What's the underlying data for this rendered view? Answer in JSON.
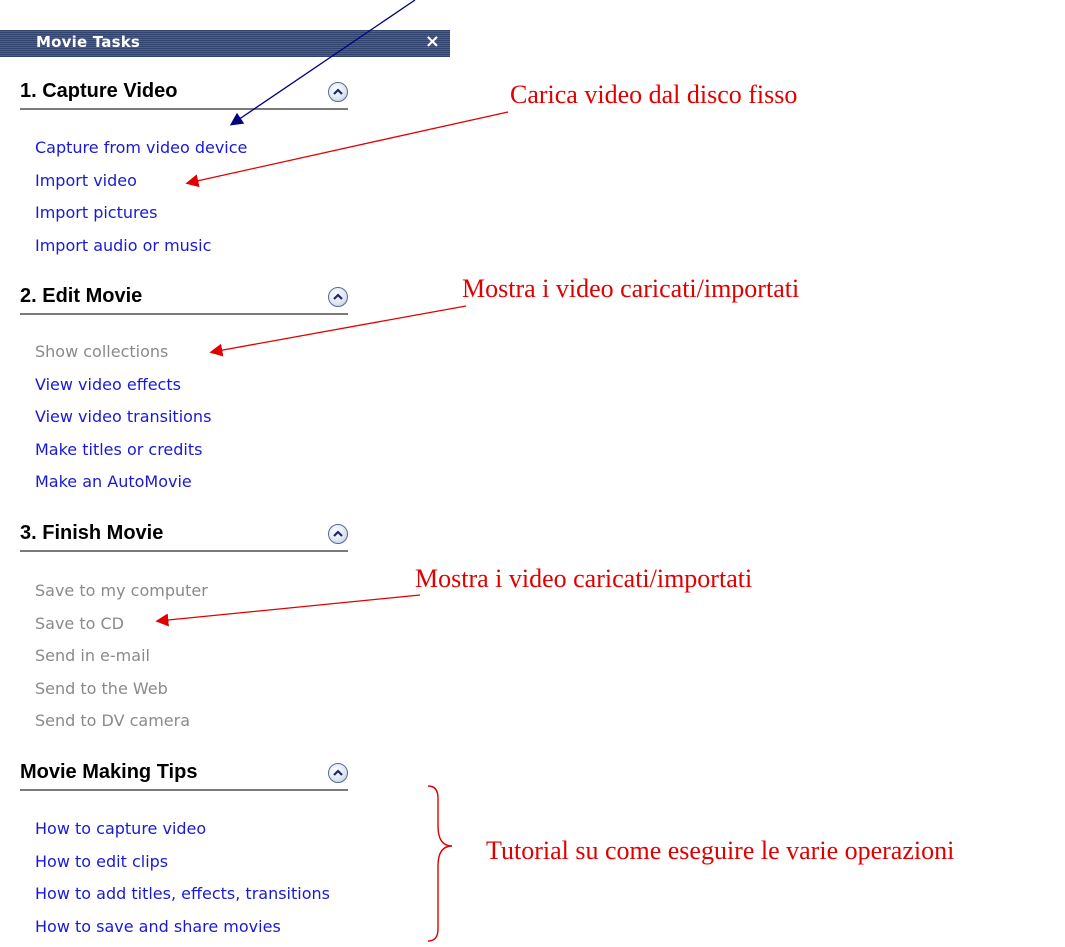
{
  "panel": {
    "title": "Movie Tasks",
    "close_glyph": "×"
  },
  "sections": [
    {
      "heading": "1. Capture Video",
      "links": [
        {
          "label": "Capture from video device",
          "state": "active"
        },
        {
          "label": "Import video",
          "state": "active"
        },
        {
          "label": "Import pictures",
          "state": "active"
        },
        {
          "label": "Import audio or music",
          "state": "active"
        }
      ]
    },
    {
      "heading": "2. Edit Movie",
      "links": [
        {
          "label": "Show collections",
          "state": "disabled"
        },
        {
          "label": "View video effects",
          "state": "active"
        },
        {
          "label": "View video transitions",
          "state": "active"
        },
        {
          "label": "Make titles or credits",
          "state": "active"
        },
        {
          "label": "Make an AutoMovie",
          "state": "active"
        }
      ]
    },
    {
      "heading": "3. Finish Movie",
      "links": [
        {
          "label": "Save to my computer",
          "state": "disabled"
        },
        {
          "label": "Save to CD",
          "state": "disabled"
        },
        {
          "label": "Send in e-mail",
          "state": "disabled"
        },
        {
          "label": "Send to the Web",
          "state": "disabled"
        },
        {
          "label": "Send to DV camera",
          "state": "disabled"
        }
      ]
    },
    {
      "heading": "Movie Making Tips",
      "links": [
        {
          "label": "How to capture video",
          "state": "active"
        },
        {
          "label": "How to edit clips",
          "state": "active"
        },
        {
          "label": "How to add titles, effects, transitions",
          "state": "active"
        },
        {
          "label": "How to save and share movies",
          "state": "active"
        }
      ]
    }
  ],
  "annotations": {
    "import_video": "Carica video dal disco fisso",
    "show_collections": "Mostra i video caricati/importati",
    "save_to_cd": "Mostra i video caricati/importati",
    "tips": "Tutorial su come eseguire le varie operazioni"
  },
  "colors": {
    "link_active": "#1a1ad6",
    "link_disabled": "#8a8a8a",
    "annotation_red": "#e00000",
    "arrow_blue": "#000080",
    "titlebar": "#3b4f80"
  },
  "icons": {
    "collapse": "chevron-up-icon",
    "close": "close-icon"
  }
}
